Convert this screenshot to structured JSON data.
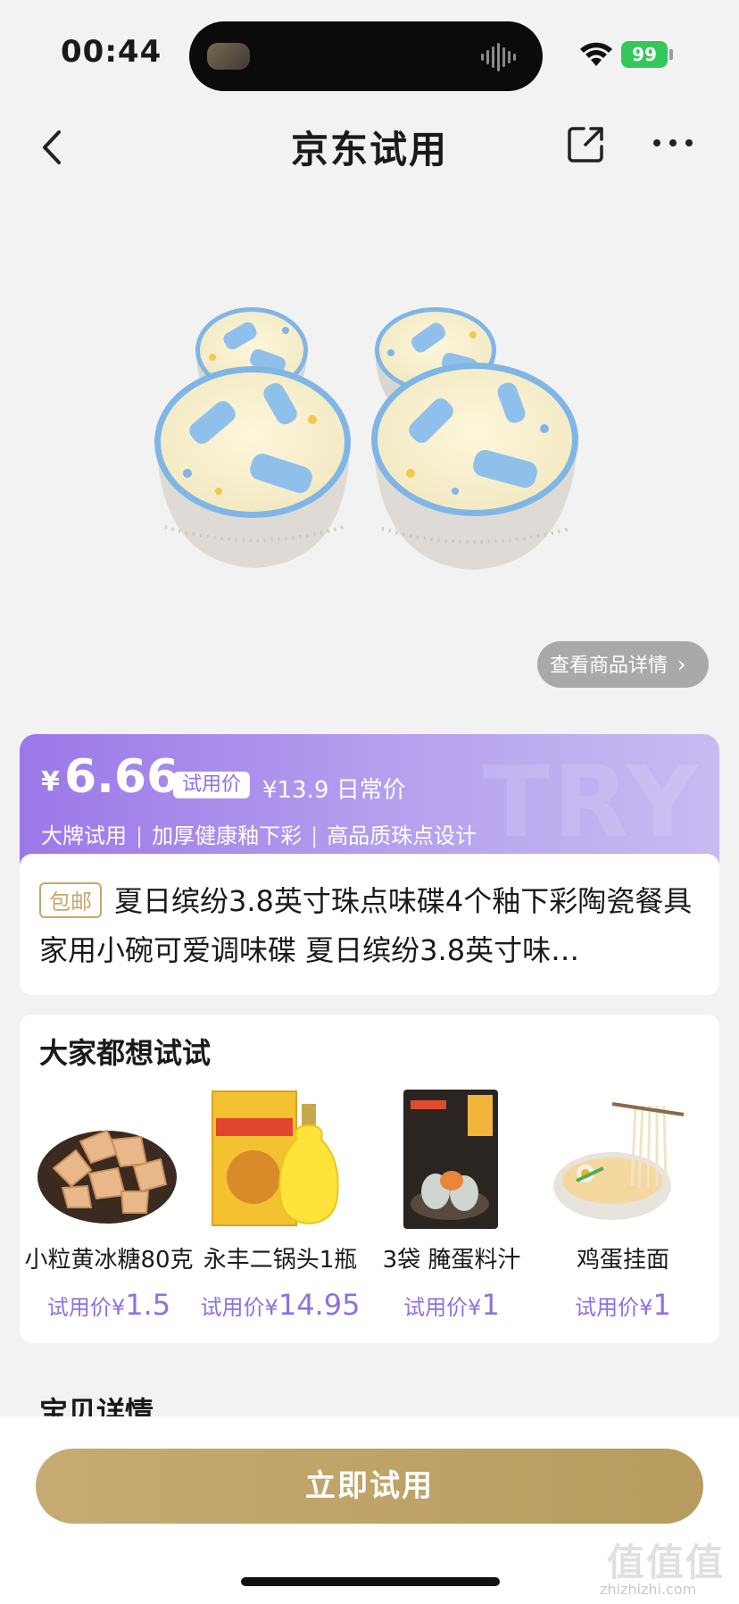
{
  "status": {
    "time": "00:44",
    "battery": "99"
  },
  "navbar": {
    "title": "京东试用"
  },
  "product": {
    "detail_link": "查看商品详情"
  },
  "price_card": {
    "currency": "¥",
    "price": "6.66",
    "try_tag": "试用价",
    "original": "¥13.9 日常价",
    "watermark": "TRY",
    "features": [
      "大牌试用",
      "加厚健康釉下彩",
      "高品质珠点设计"
    ],
    "accent": "#9b78e8"
  },
  "title_card": {
    "tag": "包邮",
    "title": "夏日缤纷3.8英寸珠点味碟4个釉下彩陶瓷餐具家用小碗可爱调味碟 夏日缤纷3.8英寸味…"
  },
  "suggestions": {
    "title": "大家都想试试",
    "items": [
      {
        "name": "小粒黄冰糖80克",
        "price_label": "试用价¥",
        "price": "1.5",
        "icon": "rock-sugar-image"
      },
      {
        "name": "永丰二锅头1瓶",
        "price_label": "试用价¥",
        "price": "14.95",
        "icon": "liquor-bottle-image"
      },
      {
        "name": "3袋 腌蛋料汁",
        "price_label": "试用价¥",
        "price": "1",
        "icon": "egg-sauce-image"
      },
      {
        "name": "鸡蛋挂面",
        "price_label": "试用价¥",
        "price": "1",
        "icon": "noodles-image"
      }
    ]
  },
  "section_peek": "宝贝详情",
  "bottom": {
    "cta": "立即试用",
    "watermark": "值值值",
    "watermark_url": "zhizhizhi.com"
  }
}
